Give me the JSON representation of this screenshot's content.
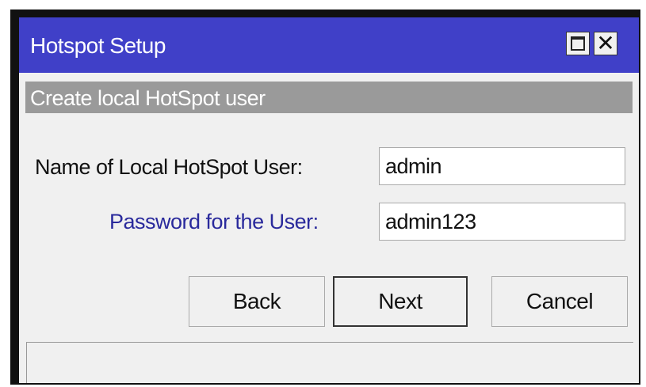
{
  "window": {
    "title": "Hotspot Setup",
    "maximize_icon": "maximize-icon",
    "close_icon": "close-icon",
    "close_glyph": "✕"
  },
  "section": {
    "header": "Create local HotSpot user"
  },
  "form": {
    "username_label": "Name of Local HotSpot User:",
    "username_value": "admin",
    "password_label": "Password for the User:",
    "password_value": "admin123"
  },
  "buttons": {
    "back": "Back",
    "next": "Next",
    "cancel": "Cancel"
  },
  "colors": {
    "titlebar": "#4040c8",
    "section_header": "#9a9a9a",
    "password_label": "#2a2a9c"
  }
}
